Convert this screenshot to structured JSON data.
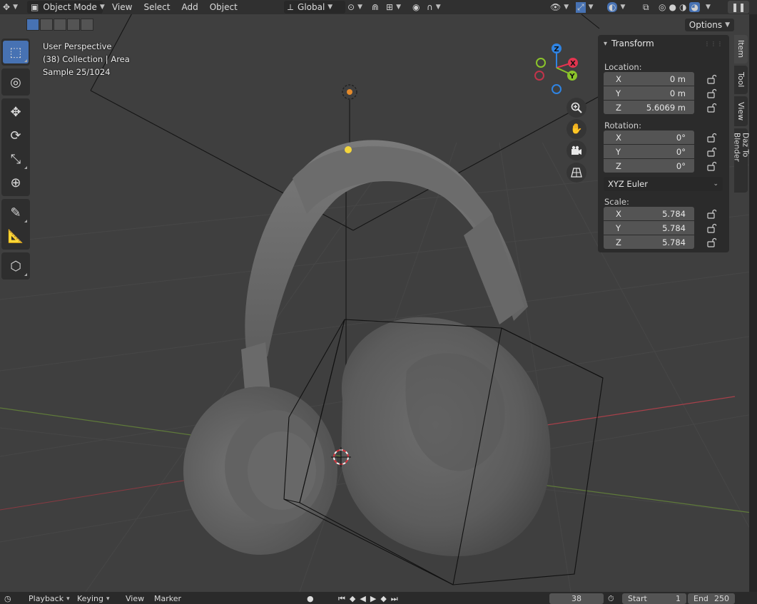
{
  "header": {
    "mode_label": "Object Mode",
    "menus": [
      "View",
      "Select",
      "Add",
      "Object"
    ],
    "orientation_label": "Global",
    "options_label": "Options"
  },
  "viewport_info": {
    "perspective": "User Perspective",
    "collection": "(38) Collection | Area",
    "sample": "Sample 25/1024"
  },
  "gizmo": {
    "x": "X",
    "y": "Y",
    "z": "Z"
  },
  "transform": {
    "title": "Transform",
    "location_label": "Location:",
    "rotation_label": "Rotation:",
    "scale_label": "Scale:",
    "location": [
      {
        "axis": "X",
        "value": "0 m"
      },
      {
        "axis": "Y",
        "value": "0 m"
      },
      {
        "axis": "Z",
        "value": "5.6069 m"
      }
    ],
    "rotation": [
      {
        "axis": "X",
        "value": "0°"
      },
      {
        "axis": "Y",
        "value": "0°"
      },
      {
        "axis": "Z",
        "value": "0°"
      }
    ],
    "rotation_mode": "XYZ Euler",
    "scale": [
      {
        "axis": "X",
        "value": "5.784"
      },
      {
        "axis": "Y",
        "value": "5.784"
      },
      {
        "axis": "Z",
        "value": "5.784"
      }
    ]
  },
  "side_tabs": [
    "Item",
    "Tool",
    "View",
    "Daz To Blender"
  ],
  "timeline": {
    "playback": "Playback",
    "keying": "Keying",
    "view": "View",
    "marker": "Marker",
    "current_frame": "38",
    "start_label": "Start",
    "start_value": "1",
    "end_label": "End",
    "end_value": "250"
  },
  "colors": {
    "accent": "#4772b3",
    "axis_x": "#e3344f",
    "axis_y": "#8bc42a",
    "axis_z": "#2f84e3"
  }
}
